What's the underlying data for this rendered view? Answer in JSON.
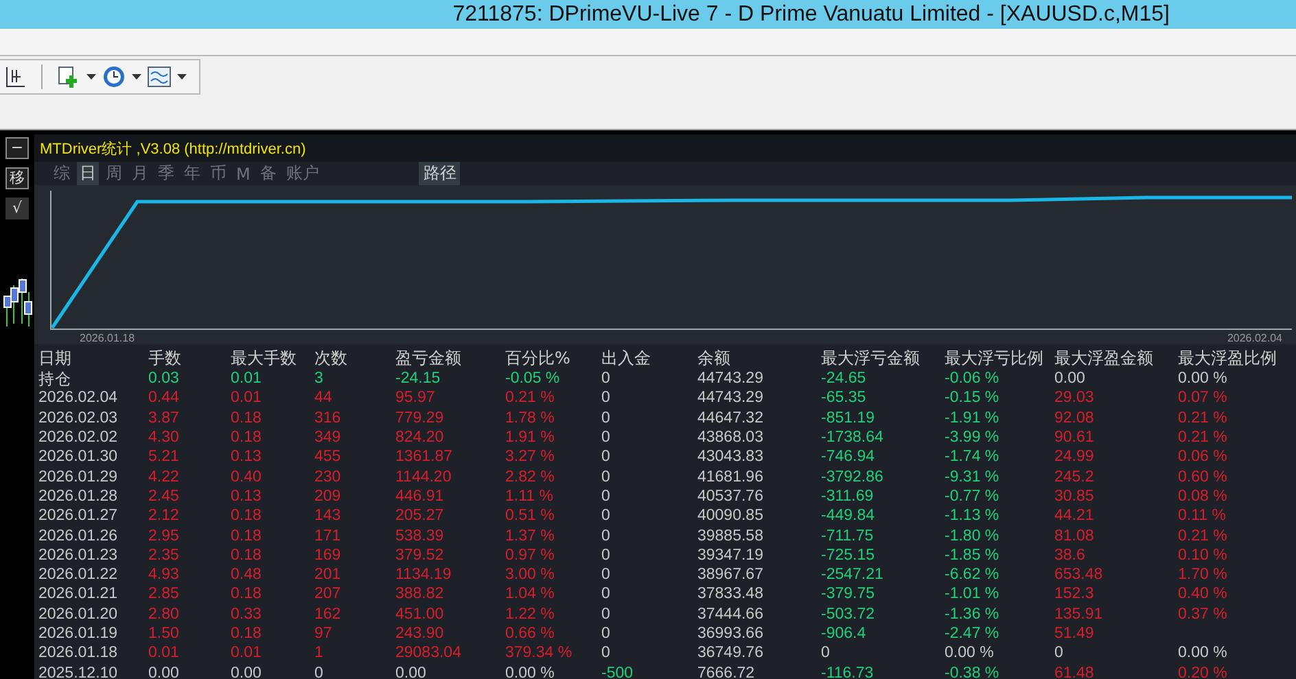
{
  "window": {
    "title": "7211875: DPrimeVU-Live 7 - D Prime Vanuatu Limited - [XAUUSD.c,M15]"
  },
  "side_buttons": [
    "−",
    "移",
    "√"
  ],
  "panel": {
    "title": "MTDriver统计 ,V3.08 (http://mtdriver.cn)"
  },
  "tabs": [
    {
      "label": "综",
      "selected": false
    },
    {
      "label": "日",
      "selected": true
    },
    {
      "label": "周",
      "selected": false
    },
    {
      "label": "月",
      "selected": false
    },
    {
      "label": "季",
      "selected": false
    },
    {
      "label": "年",
      "selected": false
    },
    {
      "label": "币",
      "selected": false
    },
    {
      "label": "M",
      "selected": false
    },
    {
      "label": "备",
      "selected": false
    },
    {
      "label": "账户",
      "selected": false
    }
  ],
  "path_button": "路径",
  "chart": {
    "start_label": "2026.01.18",
    "end_label": "2026.02.04"
  },
  "table": {
    "columns": [
      "日期",
      "手数",
      "最大手数",
      "次数",
      "盈亏金额",
      "百分比%",
      "出入金",
      "余额",
      "最大浮亏金额",
      "最大浮亏比例",
      "最大浮盈金额",
      "最大浮盈比例"
    ],
    "rows": [
      {
        "cells": [
          {
            "text": "持仓",
            "color": "#d0d0d0"
          },
          {
            "text": "0.03",
            "color": "#1fd17a"
          },
          {
            "text": "0.01",
            "color": "#1fd17a"
          },
          {
            "text": "3",
            "color": "#1fd17a"
          },
          {
            "text": "-24.15",
            "color": "#1fd17a"
          },
          {
            "text": "-0.05 %",
            "color": "#1fd17a"
          },
          {
            "text": "0",
            "color": "#c8c8c8"
          },
          {
            "text": "44743.29",
            "color": "#c8c8c8"
          },
          {
            "text": "-24.65",
            "color": "#1fd17a"
          },
          {
            "text": "-0.06 %",
            "color": "#1fd17a"
          },
          {
            "text": "0.00",
            "color": "#c8c8c8"
          },
          {
            "text": "0.00 %",
            "color": "#c8c8c8"
          }
        ]
      },
      {
        "cells": [
          {
            "text": "2026.02.04",
            "color": "#c8c8c8"
          },
          {
            "text": "0.44",
            "color": "#d81e2c"
          },
          {
            "text": "0.01",
            "color": "#d81e2c"
          },
          {
            "text": "44",
            "color": "#d81e2c"
          },
          {
            "text": "95.97",
            "color": "#d81e2c"
          },
          {
            "text": "0.21 %",
            "color": "#d81e2c"
          },
          {
            "text": "0",
            "color": "#c8c8c8"
          },
          {
            "text": "44743.29",
            "color": "#c8c8c8"
          },
          {
            "text": "-65.35",
            "color": "#1fd17a"
          },
          {
            "text": "-0.15 %",
            "color": "#1fd17a"
          },
          {
            "text": "29.03",
            "color": "#d81e2c"
          },
          {
            "text": "0.07 %",
            "color": "#d81e2c"
          }
        ]
      },
      {
        "cells": [
          {
            "text": "2026.02.03",
            "color": "#c8c8c8"
          },
          {
            "text": "3.87",
            "color": "#d81e2c"
          },
          {
            "text": "0.18",
            "color": "#d81e2c"
          },
          {
            "text": "316",
            "color": "#d81e2c"
          },
          {
            "text": "779.29",
            "color": "#d81e2c"
          },
          {
            "text": "1.78 %",
            "color": "#d81e2c"
          },
          {
            "text": "0",
            "color": "#c8c8c8"
          },
          {
            "text": "44647.32",
            "color": "#c8c8c8"
          },
          {
            "text": "-851.19",
            "color": "#1fd17a"
          },
          {
            "text": "-1.91 %",
            "color": "#1fd17a"
          },
          {
            "text": "92.08",
            "color": "#d81e2c"
          },
          {
            "text": "0.21 %",
            "color": "#d81e2c"
          }
        ]
      },
      {
        "cells": [
          {
            "text": "2026.02.02",
            "color": "#c8c8c8"
          },
          {
            "text": "4.30",
            "color": "#d81e2c"
          },
          {
            "text": "0.18",
            "color": "#d81e2c"
          },
          {
            "text": "349",
            "color": "#d81e2c"
          },
          {
            "text": "824.20",
            "color": "#d81e2c"
          },
          {
            "text": "1.91 %",
            "color": "#d81e2c"
          },
          {
            "text": "0",
            "color": "#c8c8c8"
          },
          {
            "text": "43868.03",
            "color": "#c8c8c8"
          },
          {
            "text": "-1738.64",
            "color": "#1fd17a"
          },
          {
            "text": "-3.99 %",
            "color": "#1fd17a"
          },
          {
            "text": "90.61",
            "color": "#d81e2c"
          },
          {
            "text": "0.21 %",
            "color": "#d81e2c"
          }
        ]
      },
      {
        "cells": [
          {
            "text": "2026.01.30",
            "color": "#c8c8c8"
          },
          {
            "text": "5.21",
            "color": "#d81e2c"
          },
          {
            "text": "0.13",
            "color": "#d81e2c"
          },
          {
            "text": "455",
            "color": "#d81e2c"
          },
          {
            "text": "1361.87",
            "color": "#d81e2c"
          },
          {
            "text": "3.27 %",
            "color": "#d81e2c"
          },
          {
            "text": "0",
            "color": "#c8c8c8"
          },
          {
            "text": "43043.83",
            "color": "#c8c8c8"
          },
          {
            "text": "-746.94",
            "color": "#1fd17a"
          },
          {
            "text": "-1.74 %",
            "color": "#1fd17a"
          },
          {
            "text": "24.99",
            "color": "#d81e2c"
          },
          {
            "text": "0.06 %",
            "color": "#d81e2c"
          }
        ]
      },
      {
        "cells": [
          {
            "text": "2026.01.29",
            "color": "#c8c8c8"
          },
          {
            "text": "4.22",
            "color": "#d81e2c"
          },
          {
            "text": "0.40",
            "color": "#d81e2c"
          },
          {
            "text": "230",
            "color": "#d81e2c"
          },
          {
            "text": "1144.20",
            "color": "#d81e2c"
          },
          {
            "text": "2.82 %",
            "color": "#d81e2c"
          },
          {
            "text": "0",
            "color": "#c8c8c8"
          },
          {
            "text": "41681.96",
            "color": "#c8c8c8"
          },
          {
            "text": "-3792.86",
            "color": "#1fd17a"
          },
          {
            "text": "-9.31 %",
            "color": "#1fd17a"
          },
          {
            "text": "245.2",
            "color": "#d81e2c"
          },
          {
            "text": "0.60 %",
            "color": "#d81e2c"
          }
        ]
      },
      {
        "cells": [
          {
            "text": "2026.01.28",
            "color": "#c8c8c8"
          },
          {
            "text": "2.45",
            "color": "#d81e2c"
          },
          {
            "text": "0.13",
            "color": "#d81e2c"
          },
          {
            "text": "209",
            "color": "#d81e2c"
          },
          {
            "text": "446.91",
            "color": "#d81e2c"
          },
          {
            "text": "1.11 %",
            "color": "#d81e2c"
          },
          {
            "text": "0",
            "color": "#c8c8c8"
          },
          {
            "text": "40537.76",
            "color": "#c8c8c8"
          },
          {
            "text": "-311.69",
            "color": "#1fd17a"
          },
          {
            "text": "-0.77 %",
            "color": "#1fd17a"
          },
          {
            "text": "30.85",
            "color": "#d81e2c"
          },
          {
            "text": "0.08 %",
            "color": "#d81e2c"
          }
        ]
      },
      {
        "cells": [
          {
            "text": "2026.01.27",
            "color": "#c8c8c8"
          },
          {
            "text": "2.12",
            "color": "#d81e2c"
          },
          {
            "text": "0.18",
            "color": "#d81e2c"
          },
          {
            "text": "143",
            "color": "#d81e2c"
          },
          {
            "text": "205.27",
            "color": "#d81e2c"
          },
          {
            "text": "0.51 %",
            "color": "#d81e2c"
          },
          {
            "text": "0",
            "color": "#c8c8c8"
          },
          {
            "text": "40090.85",
            "color": "#c8c8c8"
          },
          {
            "text": "-449.84",
            "color": "#1fd17a"
          },
          {
            "text": "-1.13 %",
            "color": "#1fd17a"
          },
          {
            "text": "44.21",
            "color": "#d81e2c"
          },
          {
            "text": "0.11 %",
            "color": "#d81e2c"
          }
        ]
      },
      {
        "cells": [
          {
            "text": "2026.01.26",
            "color": "#c8c8c8"
          },
          {
            "text": "2.95",
            "color": "#d81e2c"
          },
          {
            "text": "0.18",
            "color": "#d81e2c"
          },
          {
            "text": "171",
            "color": "#d81e2c"
          },
          {
            "text": "538.39",
            "color": "#d81e2c"
          },
          {
            "text": "1.37 %",
            "color": "#d81e2c"
          },
          {
            "text": "0",
            "color": "#c8c8c8"
          },
          {
            "text": "39885.58",
            "color": "#c8c8c8"
          },
          {
            "text": "-711.75",
            "color": "#1fd17a"
          },
          {
            "text": "-1.80 %",
            "color": "#1fd17a"
          },
          {
            "text": "81.08",
            "color": "#d81e2c"
          },
          {
            "text": "0.21 %",
            "color": "#d81e2c"
          }
        ]
      },
      {
        "cells": [
          {
            "text": "2026.01.23",
            "color": "#c8c8c8"
          },
          {
            "text": "2.35",
            "color": "#d81e2c"
          },
          {
            "text": "0.18",
            "color": "#d81e2c"
          },
          {
            "text": "169",
            "color": "#d81e2c"
          },
          {
            "text": "379.52",
            "color": "#d81e2c"
          },
          {
            "text": "0.97 %",
            "color": "#d81e2c"
          },
          {
            "text": "0",
            "color": "#c8c8c8"
          },
          {
            "text": "39347.19",
            "color": "#c8c8c8"
          },
          {
            "text": "-725.15",
            "color": "#1fd17a"
          },
          {
            "text": "-1.85 %",
            "color": "#1fd17a"
          },
          {
            "text": "38.6",
            "color": "#d81e2c"
          },
          {
            "text": "0.10 %",
            "color": "#d81e2c"
          }
        ]
      },
      {
        "cells": [
          {
            "text": "2026.01.22",
            "color": "#c8c8c8"
          },
          {
            "text": "4.93",
            "color": "#d81e2c"
          },
          {
            "text": "0.48",
            "color": "#d81e2c"
          },
          {
            "text": "201",
            "color": "#d81e2c"
          },
          {
            "text": "1134.19",
            "color": "#d81e2c"
          },
          {
            "text": "3.00 %",
            "color": "#d81e2c"
          },
          {
            "text": "0",
            "color": "#c8c8c8"
          },
          {
            "text": "38967.67",
            "color": "#c8c8c8"
          },
          {
            "text": "-2547.21",
            "color": "#1fd17a"
          },
          {
            "text": "-6.62 %",
            "color": "#1fd17a"
          },
          {
            "text": "653.48",
            "color": "#d81e2c"
          },
          {
            "text": "1.70 %",
            "color": "#d81e2c"
          }
        ]
      },
      {
        "cells": [
          {
            "text": "2026.01.21",
            "color": "#c8c8c8"
          },
          {
            "text": "2.85",
            "color": "#d81e2c"
          },
          {
            "text": "0.18",
            "color": "#d81e2c"
          },
          {
            "text": "207",
            "color": "#d81e2c"
          },
          {
            "text": "388.82",
            "color": "#d81e2c"
          },
          {
            "text": "1.04 %",
            "color": "#d81e2c"
          },
          {
            "text": "0",
            "color": "#c8c8c8"
          },
          {
            "text": "37833.48",
            "color": "#c8c8c8"
          },
          {
            "text": "-379.75",
            "color": "#1fd17a"
          },
          {
            "text": "-1.01 %",
            "color": "#1fd17a"
          },
          {
            "text": "152.3",
            "color": "#d81e2c"
          },
          {
            "text": "0.40 %",
            "color": "#d81e2c"
          }
        ]
      },
      {
        "cells": [
          {
            "text": "2026.01.20",
            "color": "#c8c8c8"
          },
          {
            "text": "2.80",
            "color": "#d81e2c"
          },
          {
            "text": "0.33",
            "color": "#d81e2c"
          },
          {
            "text": "162",
            "color": "#d81e2c"
          },
          {
            "text": "451.00",
            "color": "#d81e2c"
          },
          {
            "text": "1.22 %",
            "color": "#d81e2c"
          },
          {
            "text": "0",
            "color": "#c8c8c8"
          },
          {
            "text": "37444.66",
            "color": "#c8c8c8"
          },
          {
            "text": "-503.72",
            "color": "#1fd17a"
          },
          {
            "text": "-1.36 %",
            "color": "#1fd17a"
          },
          {
            "text": "135.91",
            "color": "#d81e2c"
          },
          {
            "text": "0.37 %",
            "color": "#d81e2c"
          }
        ]
      },
      {
        "cells": [
          {
            "text": "2026.01.19",
            "color": "#c8c8c8"
          },
          {
            "text": "1.50",
            "color": "#d81e2c"
          },
          {
            "text": "0.18",
            "color": "#d81e2c"
          },
          {
            "text": "97",
            "color": "#d81e2c"
          },
          {
            "text": "243.90",
            "color": "#d81e2c"
          },
          {
            "text": "0.66 %",
            "color": "#d81e2c"
          },
          {
            "text": "0",
            "color": "#c8c8c8"
          },
          {
            "text": "36993.66",
            "color": "#c8c8c8"
          },
          {
            "text": "-906.4",
            "color": "#1fd17a"
          },
          {
            "text": "-2.47 %",
            "color": "#1fd17a"
          },
          {
            "text": "51.49",
            "color": "#d81e2c"
          }
        ]
      },
      {
        "cells": [
          {
            "text": "2026.01.18",
            "color": "#c8c8c8"
          },
          {
            "text": "0.01",
            "color": "#d81e2c"
          },
          {
            "text": "0.01",
            "color": "#d81e2c"
          },
          {
            "text": "1",
            "color": "#d81e2c"
          },
          {
            "text": "29083.04",
            "color": "#d81e2c"
          },
          {
            "text": "379.34 %",
            "color": "#d81e2c"
          },
          {
            "text": "0",
            "color": "#c8c8c8"
          },
          {
            "text": "36749.76",
            "color": "#c8c8c8"
          },
          {
            "text": "0",
            "color": "#c8c8c8"
          },
          {
            "text": "0.00 %",
            "color": "#c8c8c8"
          },
          {
            "text": "0",
            "color": "#c8c8c8"
          },
          {
            "text": "0.00 %",
            "color": "#c8c8c8"
          }
        ]
      },
      {
        "cells": [
          {
            "text": "2025.12.10",
            "color": "#c8c8c8"
          },
          {
            "text": "0.00",
            "color": "#c8c8c8"
          },
          {
            "text": "0.00",
            "color": "#c8c8c8"
          },
          {
            "text": "0",
            "color": "#c8c8c8"
          },
          {
            "text": "0.00",
            "color": "#c8c8c8"
          },
          {
            "text": "0.00 %",
            "color": "#c8c8c8"
          },
          {
            "text": "-500",
            "color": "#1fd17a"
          },
          {
            "text": "7666.72",
            "color": "#c8c8c8"
          },
          {
            "text": "-116.73",
            "color": "#1fd17a"
          },
          {
            "text": "-0.38 %",
            "color": "#1fd17a"
          },
          {
            "text": "61.48",
            "color": "#d81e2c"
          },
          {
            "text": "0.20 %",
            "color": "#d81e2c"
          }
        ]
      }
    ]
  }
}
